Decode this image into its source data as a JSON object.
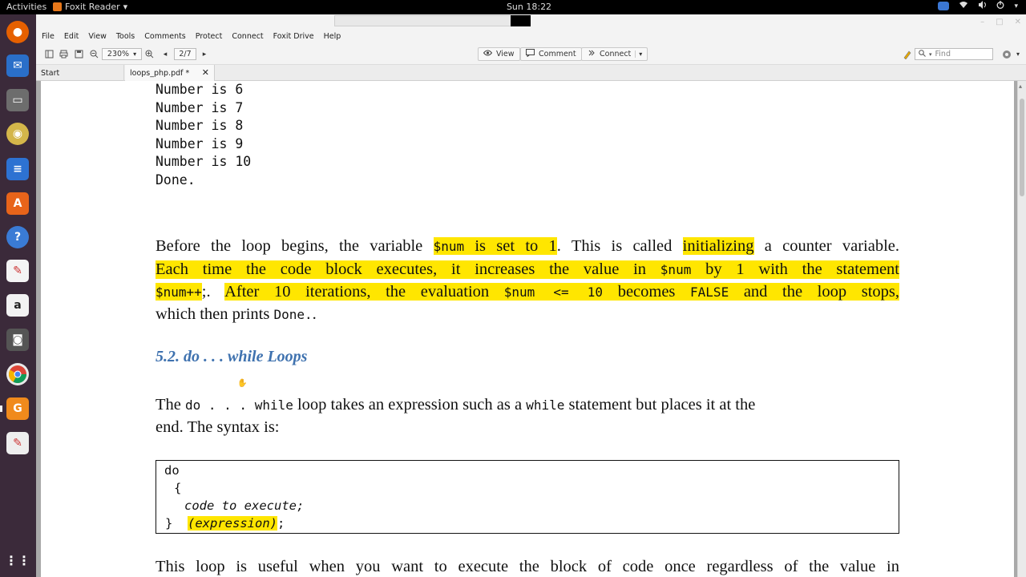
{
  "topbar": {
    "activities": "Activities",
    "app_name": "Foxit Reader",
    "app_menu_arrow": "▾",
    "clock": "Sun 18:22"
  },
  "menubar": {
    "items": [
      "File",
      "Edit",
      "View",
      "Tools",
      "Comments",
      "Protect",
      "Connect",
      "Foxit Drive",
      "Help"
    ]
  },
  "toolbar": {
    "zoom": "230%",
    "page": "2/7",
    "view_label": "View",
    "comment_label": "Comment",
    "connect_label": "Connect",
    "find_placeholder": "Find"
  },
  "tabs": {
    "start": "Start",
    "doc": "loops_php.pdf *",
    "close_glyph": "✕"
  },
  "document": {
    "output_lines": [
      "Number is 6",
      "Number is 7",
      "Number is 8",
      "Number is 9",
      "Number is 10",
      "Done."
    ],
    "para1": {
      "l1_a": "Before the loop begins, the variable ",
      "l1_code": "$num",
      "l1_b": " is set to 1",
      "l1_c": ". This is called ",
      "l1_d": "initializing",
      "l1_e": " a counter variable.",
      "l2_a": "Each time the code block executes, it increases the value in ",
      "l2_code": "$num",
      "l2_b": " by 1 with the statement",
      "l3_code1": "$num++",
      "l3_a": ";. ",
      "l3_b": "After 10 iterations, the evaluation ",
      "l3_code2": "$num <= 10",
      "l3_c": " becomes ",
      "l3_code3": "FALSE",
      "l3_d": " and the loop stops,",
      "l4_a": "which then prints ",
      "l4_code": "Done.",
      "l4_b": "."
    },
    "heading": "5.2. do . . . while Loops",
    "para2": {
      "l1_a": "The ",
      "l1_code1": "do . . . while",
      "l1_b": " loop takes an expression such as a ",
      "l1_code2": "while",
      "l1_c": " statement but places it at the",
      "l2": "end. The syntax is:"
    },
    "codebox": {
      "l1": "do",
      "l2": "{",
      "l3": "code to execute;",
      "l4_a": "}  ",
      "l4_b": "(expression)",
      "l4_c": ";"
    },
    "para3": "This loop is useful when you want to execute the block of code once regardless of the value in"
  },
  "colors": {
    "highlight": "#ffe600",
    "heading": "#3f72af",
    "launcher": "#3b2a3a"
  }
}
